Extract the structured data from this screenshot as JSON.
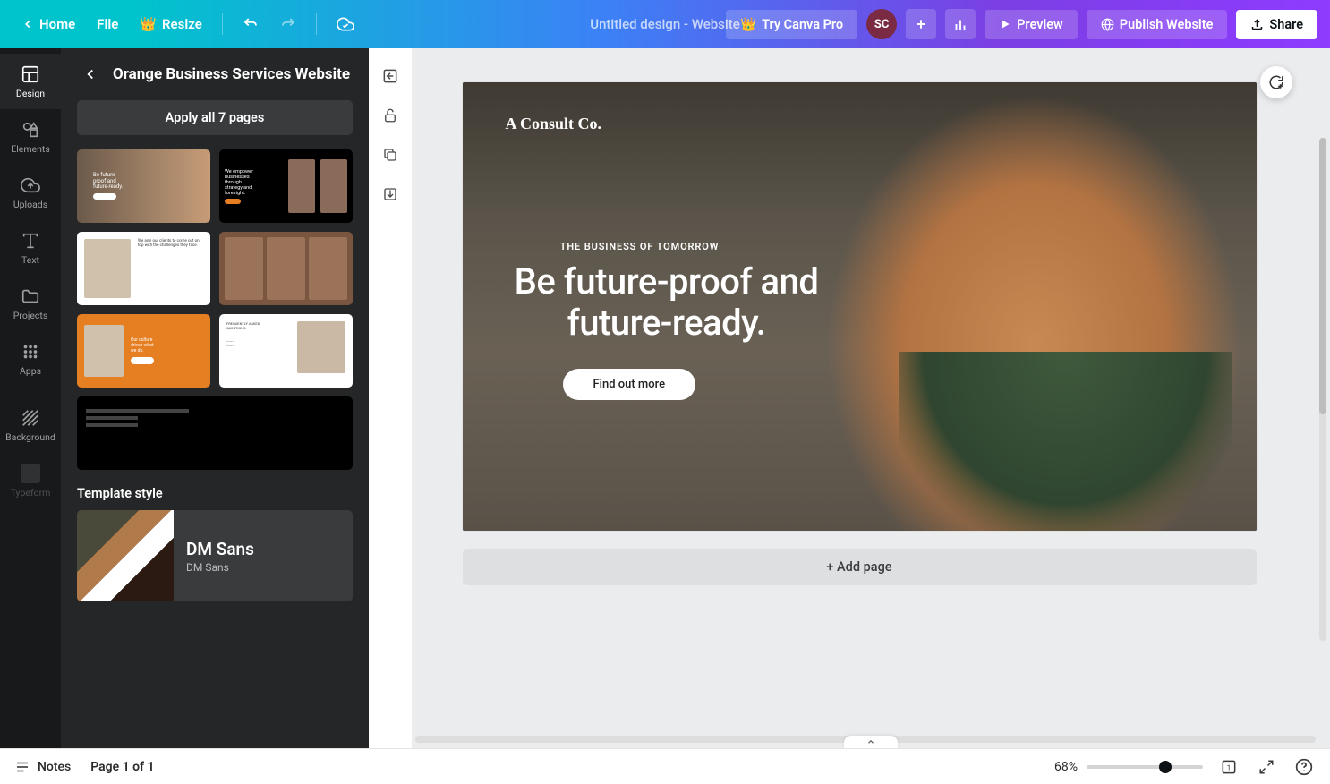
{
  "topbar": {
    "home": "Home",
    "file": "File",
    "resize": "Resize",
    "doc_title": "Untitled design - Website",
    "try_pro": "Try Canva Pro",
    "avatar_initials": "SC",
    "preview": "Preview",
    "publish": "Publish Website",
    "share": "Share"
  },
  "rail": {
    "items": [
      {
        "label": "Design"
      },
      {
        "label": "Elements"
      },
      {
        "label": "Uploads"
      },
      {
        "label": "Text"
      },
      {
        "label": "Projects"
      },
      {
        "label": "Apps"
      },
      {
        "label": "Background"
      },
      {
        "label": "Typeform"
      }
    ]
  },
  "panel": {
    "title": "Orange Business Services Website",
    "apply_label": "Apply all 7 pages",
    "style_section": "Template style",
    "style_name": "DM Sans",
    "style_sub": "DM Sans"
  },
  "canvas": {
    "brand": "A Consult Co.",
    "kicker": "THE BUSINESS OF TOMORROW",
    "headline": "Be future-proof and future-ready.",
    "cta": "Find out more",
    "add_page": "+ Add page"
  },
  "bottombar": {
    "notes": "Notes",
    "page_indicator": "Page 1 of 1",
    "zoom_pct": "68%"
  }
}
